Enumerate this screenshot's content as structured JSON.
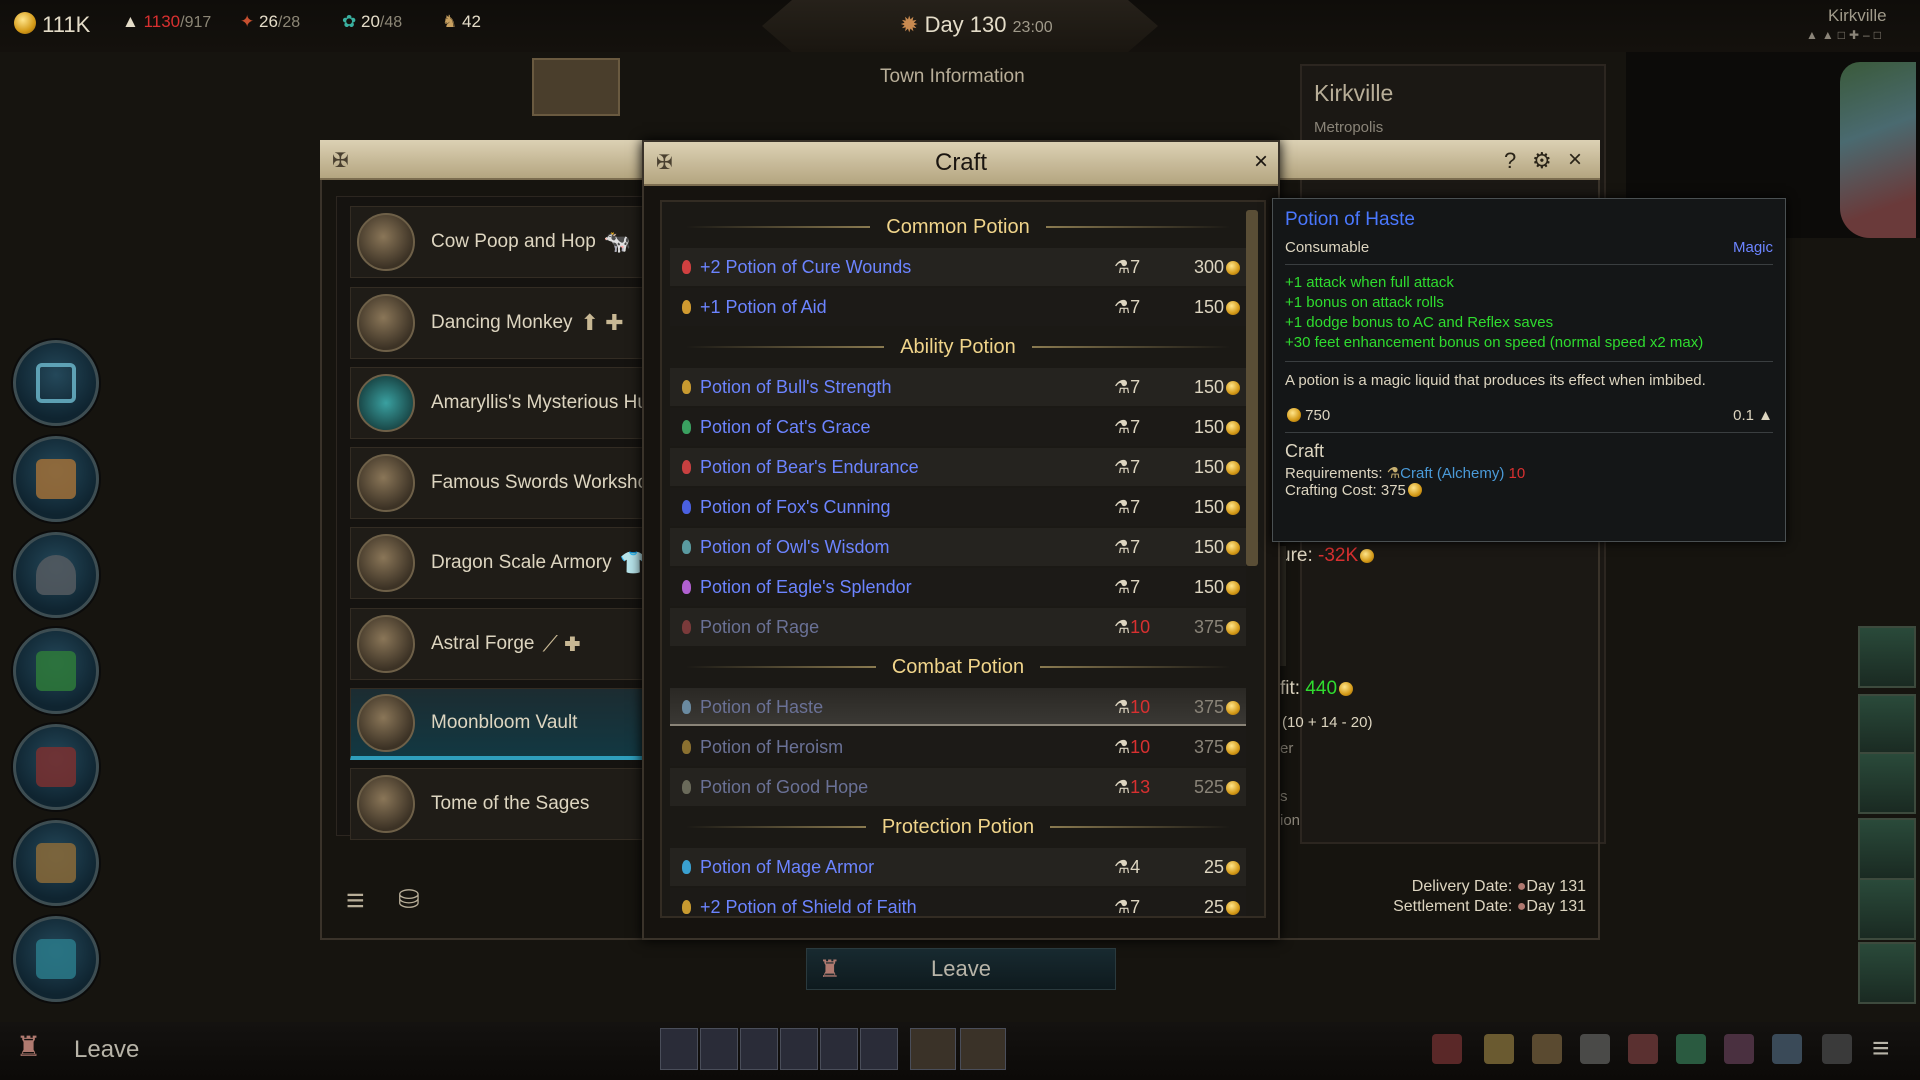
{
  "topbar": {
    "gold": "111K",
    "population_current": "1130",
    "population_max": "/917",
    "resource1_current": "26",
    "resource1_max": "/28",
    "resource2_current": "20",
    "resource2_max": "/48",
    "resource3": "42",
    "day": "Day 130",
    "time": "23:00",
    "town_name": "Kirkville"
  },
  "background": {
    "town_info_title": "Town Information",
    "town_name": "Kirkville",
    "town_type": "Metropolis",
    "expenditure_label": "ure:",
    "expenditure_value": "-32K",
    "profit_label": "fit:",
    "profit_value": "440",
    "formula": "(10 + 14 - 20)",
    "frag1": "er",
    "frag2": "s",
    "frag3": "ion",
    "delivery_label": "Delivery Date:",
    "delivery_value": "Day 131",
    "settlement_label": "Settlement Date:",
    "settlement_value": "Day 131"
  },
  "establishments": [
    {
      "label": "Cow Poop and Hop",
      "badge": "🐄"
    },
    {
      "label": "Dancing Monkey",
      "badge": "⬆ ✚"
    },
    {
      "label": "Amaryllis's Mysterious Hut",
      "badge": ""
    },
    {
      "label": "Famous Swords Workshop",
      "badge": ""
    },
    {
      "label": "Dragon Scale Armory",
      "badge": "👕"
    },
    {
      "label": "Astral Forge",
      "badge": "⟋ ✚"
    },
    {
      "label": "Moonbloom Vault",
      "badge": ""
    },
    {
      "label": "Tome of the Sages",
      "badge": ""
    }
  ],
  "craft": {
    "title": "Craft",
    "close": "×",
    "sections": {
      "common": "Common Potion",
      "ability": "Ability Potion",
      "combat": "Combat Potion",
      "protection": "Protection Potion"
    },
    "items": [
      {
        "name": "+2 Potion of Cure Wounds",
        "skill": "7",
        "price": "300"
      },
      {
        "name": "+1 Potion of Aid",
        "skill": "7",
        "price": "150"
      },
      {
        "name": "Potion of Bull's Strength",
        "skill": "7",
        "price": "150"
      },
      {
        "name": "Potion of Cat's Grace",
        "skill": "7",
        "price": "150"
      },
      {
        "name": "Potion of Bear's Endurance",
        "skill": "7",
        "price": "150"
      },
      {
        "name": "Potion of Fox's Cunning",
        "skill": "7",
        "price": "150"
      },
      {
        "name": "Potion of Owl's Wisdom",
        "skill": "7",
        "price": "150"
      },
      {
        "name": "Potion of Eagle's Splendor",
        "skill": "7",
        "price": "150"
      },
      {
        "name": "Potion of Rage",
        "skill": "10",
        "price": "375"
      },
      {
        "name": "Potion of Haste",
        "skill": "10",
        "price": "375"
      },
      {
        "name": "Potion of Heroism",
        "skill": "10",
        "price": "375"
      },
      {
        "name": "Potion of Good Hope",
        "skill": "13",
        "price": "525"
      },
      {
        "name": "Potion of Mage Armor",
        "skill": "4",
        "price": "25"
      },
      {
        "name": "+2 Potion of Shield of Faith",
        "skill": "7",
        "price": "25"
      }
    ]
  },
  "tooltip": {
    "title": "Potion of Haste",
    "type": "Consumable",
    "rarity": "Magic",
    "effects": [
      "+1 attack when full attack",
      "+1 bonus on attack rolls",
      "+1 dodge bonus to AC and Reflex saves",
      "+30 feet enhancement bonus on speed (normal speed x2 max)"
    ],
    "description": "A potion is a magic liquid that produces its effect when imbibed.",
    "value": "750",
    "weight": "0.1",
    "craft_header": "Craft",
    "requirements_label": "Requirements:",
    "requirement_skill": "Craft (Alchemy)",
    "requirement_value": "10",
    "cost_label": "Crafting Cost:",
    "cost_value": "375"
  },
  "buttons": {
    "leave_center": "Leave",
    "leave_bottom": "Leave",
    "help": "?",
    "settings_icon": "gear-icon",
    "close_outer": "×"
  },
  "colors": {
    "accent_gold": "#e8b740",
    "item_blue": "#6c84ff",
    "disabled_blue": "#6a7196",
    "effect_green": "#2fdc2f",
    "negative_red": "#d83030",
    "selected_teal": "#2f9fbd"
  }
}
